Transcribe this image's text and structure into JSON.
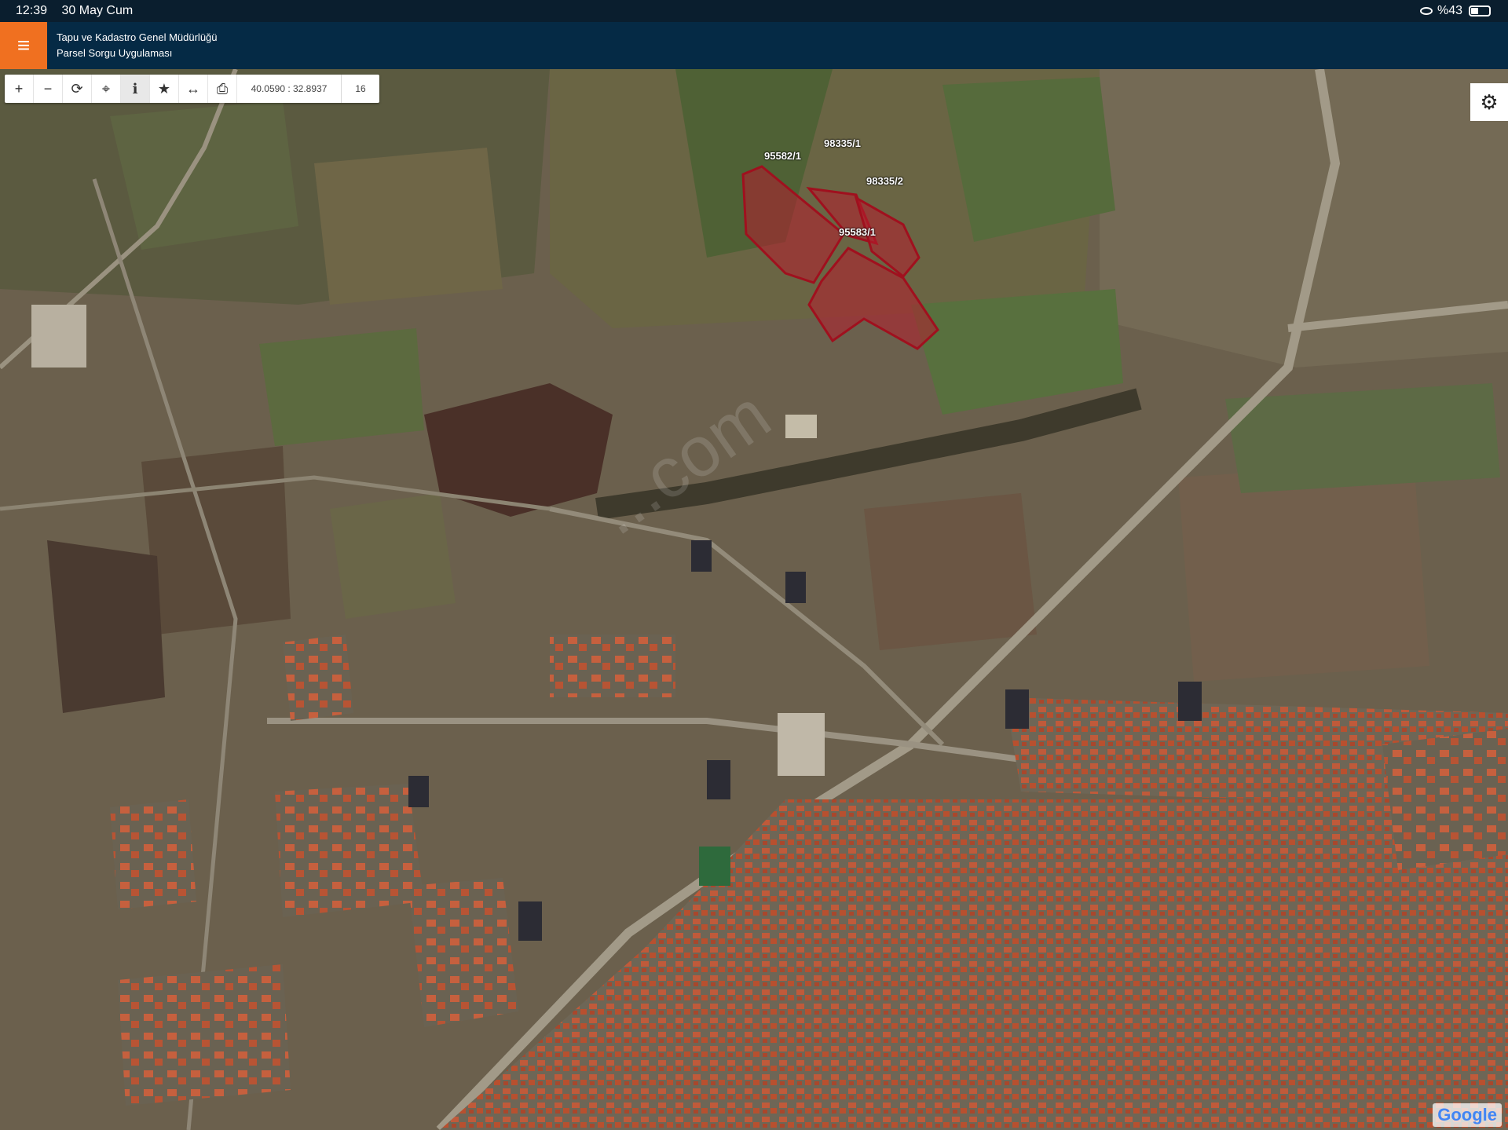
{
  "status_bar": {
    "time": "12:39",
    "date": "30 May Cum",
    "battery": "%43",
    "battery_level": 0.43
  },
  "header": {
    "title_line1": "Tapu ve Kadastro Genel Müdürlüğü",
    "title_line2": "Parsel Sorgu Uygulaması"
  },
  "toolbar": {
    "buttons": [
      {
        "icon": "plus-icon",
        "glyph": "+"
      },
      {
        "icon": "minus-icon",
        "glyph": "−"
      },
      {
        "icon": "refresh-icon",
        "glyph": "⟳"
      },
      {
        "icon": "locate-icon",
        "glyph": "⌖"
      },
      {
        "icon": "info-icon",
        "glyph": "i"
      },
      {
        "icon": "star-icon",
        "glyph": "★"
      },
      {
        "icon": "measure-icon",
        "glyph": "↔"
      },
      {
        "icon": "print-icon",
        "glyph": "⎙"
      }
    ],
    "coordinates": "40.0590 : 32.8937",
    "zoom": "16"
  },
  "parcels": [
    {
      "label": "95582/1"
    },
    {
      "label": "98335/1"
    },
    {
      "label": "98335/2"
    },
    {
      "label": "95583/1"
    }
  ],
  "watermark": "...com",
  "attribution": "Google",
  "colors": {
    "header_bg": "#052a45",
    "menu_accent": "#f07020",
    "parcel_fill": "#b41e2d",
    "parcel_stroke": "#a0101e"
  }
}
